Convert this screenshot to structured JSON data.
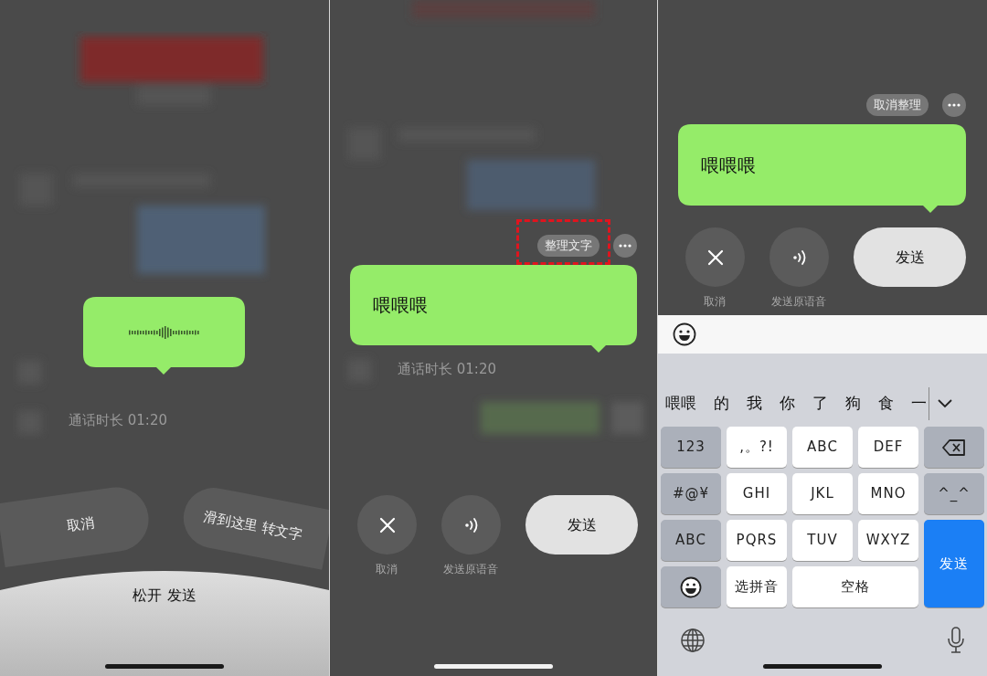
{
  "panels": [
    {
      "kind": "recording",
      "background_texts": [
        "通话时长 01:20"
      ],
      "bubble": {
        "kind": "waveform"
      },
      "cancel_zone": "取消",
      "convert_zone": "滑到这里 转文字",
      "release_label": "松开 发送"
    },
    {
      "kind": "transcribed",
      "background_texts": [
        "通话时长 01:20"
      ],
      "chip": {
        "label": "整理文字",
        "highlighted": true
      },
      "bubble": {
        "kind": "text",
        "text": "喂喂喂"
      },
      "actions": [
        {
          "kind": "cancel",
          "label": "取消"
        },
        {
          "kind": "voice",
          "label": "发送原语音"
        },
        {
          "kind": "send",
          "label": "发送"
        }
      ]
    },
    {
      "kind": "keyboard",
      "chip": {
        "label": "取消整理",
        "highlighted": false
      },
      "bubble": {
        "kind": "text",
        "text": "喂喂喂"
      },
      "actions": [
        {
          "kind": "cancel",
          "label": "取消"
        },
        {
          "kind": "voice",
          "label": "发送原语音"
        },
        {
          "kind": "send",
          "label": "发送"
        }
      ],
      "keyboard": {
        "candidates": [
          "喂喂",
          "的",
          "我",
          "你",
          "了",
          "狗",
          "食",
          "一"
        ],
        "keys": [
          {
            "kind": "function",
            "label": "123"
          },
          {
            "kind": "letter",
            "label": ",。?!"
          },
          {
            "kind": "letter",
            "label": "ABC"
          },
          {
            "kind": "letter",
            "label": "DEF"
          },
          {
            "kind": "delete"
          },
          {
            "kind": "function",
            "label": "#@¥"
          },
          {
            "kind": "letter",
            "label": "GHI"
          },
          {
            "kind": "letter",
            "label": "JKL"
          },
          {
            "kind": "letter",
            "label": "MNO"
          },
          {
            "kind": "function",
            "label": "^_^"
          },
          {
            "kind": "function",
            "label": "ABC"
          },
          {
            "kind": "letter",
            "label": "PQRS"
          },
          {
            "kind": "letter",
            "label": "TUV"
          },
          {
            "kind": "letter",
            "label": "WXYZ"
          },
          {
            "kind": "send",
            "label": "发送"
          },
          {
            "kind": "emoji"
          },
          {
            "kind": "letter",
            "label": "选拼音"
          },
          {
            "kind": "space",
            "label": "空格"
          }
        ]
      }
    }
  ]
}
